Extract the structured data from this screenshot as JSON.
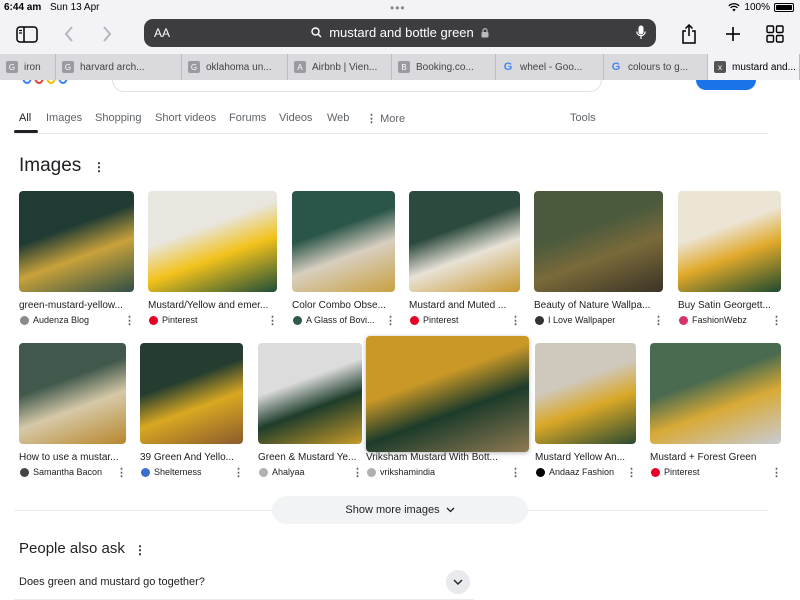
{
  "status_bar": {
    "time": "6:44 am",
    "date": "Sun 13 Apr",
    "battery": "100%"
  },
  "address_bar": {
    "text_size_label": "AA",
    "query": "mustard and bottle green"
  },
  "tabs": [
    {
      "label": "iron",
      "favicon": "G",
      "favicon_kind": "grey"
    },
    {
      "label": "harvard arch...",
      "favicon": "G",
      "favicon_kind": "grey"
    },
    {
      "label": "oklahoma un...",
      "favicon": "G",
      "favicon_kind": "grey"
    },
    {
      "label": "Airbnb | Vien...",
      "favicon": "A",
      "favicon_kind": "grey"
    },
    {
      "label": "Booking.co...",
      "favicon": "B",
      "favicon_kind": "grey"
    },
    {
      "label": "wheel - Goo...",
      "favicon": "G",
      "favicon_kind": "google"
    },
    {
      "label": "colours to g...",
      "favicon": "G",
      "favicon_kind": "google"
    },
    {
      "label": "mustard and...",
      "favicon": "x",
      "favicon_kind": "active"
    }
  ],
  "search_nav": {
    "items": [
      "All",
      "Images",
      "Shopping",
      "Short videos",
      "Forums",
      "Videos",
      "Web",
      "More"
    ],
    "tools": "Tools"
  },
  "images_section": {
    "title": "Images"
  },
  "image_results": [
    {
      "caption": "green-mustard-yellow...",
      "source": "Audenza Blog",
      "fav_color": "#8a8a8a",
      "colors": [
        "#1f3b33",
        "#c9a23b",
        "#2f4f45"
      ]
    },
    {
      "caption": "Mustard/Yellow and emer...",
      "source": "Pinterest",
      "fav_color": "#e60023",
      "colors": [
        "#e8e6df",
        "#f2c21b",
        "#1e4d38"
      ]
    },
    {
      "caption": "Color Combo Obse...",
      "source": "A Glass of Bovi...",
      "fav_color": "#2e5a4a",
      "colors": [
        "#2a5549",
        "#d8cfc0",
        "#c9a040"
      ]
    },
    {
      "caption": "Mustard and Muted ...",
      "source": "Pinterest",
      "fav_color": "#e60023",
      "colors": [
        "#2d4a3e",
        "#e8e2d6",
        "#c8972f"
      ]
    },
    {
      "caption": "Beauty of Nature Wallpa...",
      "source": "I Love Wallpaper",
      "fav_color": "#333333",
      "colors": [
        "#4b5a3d",
        "#7a6a3a",
        "#3a3326"
      ]
    },
    {
      "caption": "Buy Satin Georgett...",
      "source": "FashionWebz",
      "fav_color": "#d6336c",
      "colors": [
        "#ece4d4",
        "#e0a92a",
        "#1e4a2f"
      ]
    },
    {
      "caption": "How to use a mustar...",
      "source": "Samantha Bacon",
      "fav_color": "#444444",
      "colors": [
        "#41594d",
        "#d6c9a8",
        "#b8862c"
      ]
    },
    {
      "caption": "39 Green And Yello...",
      "source": "Shelterness",
      "fav_color": "#3b6ed0",
      "colors": [
        "#243d30",
        "#d9a821",
        "#8a5a2e"
      ]
    },
    {
      "caption": "Green & Mustard Ye...",
      "source": "Ahalyaa",
      "fav_color": "#b0b0b0",
      "colors": [
        "#dcdcdc",
        "#1e3d2b",
        "#c99a2a"
      ]
    },
    {
      "caption": "Vriksham Mustard With Bott...",
      "source": "vrikshamindia",
      "fav_color": "#b0b0b0",
      "colors": [
        "#c99827",
        "#1d3b2a",
        "#8f7a52"
      ]
    },
    {
      "caption": "Mustard Yellow An...",
      "source": "Andaaz Fashion",
      "fav_color": "#000000",
      "colors": [
        "#cfc9bd",
        "#d9a726",
        "#2a4a32"
      ]
    },
    {
      "caption": "Mustard + Forest Green",
      "source": "Pinterest",
      "fav_color": "#e60023",
      "colors": [
        "#4a6b4f",
        "#d8a936",
        "#c9ccd4"
      ]
    }
  ],
  "show_more": {
    "label": "Show more images"
  },
  "people_also_ask": {
    "title": "People also ask",
    "questions": [
      "Does green and mustard go together?"
    ]
  }
}
